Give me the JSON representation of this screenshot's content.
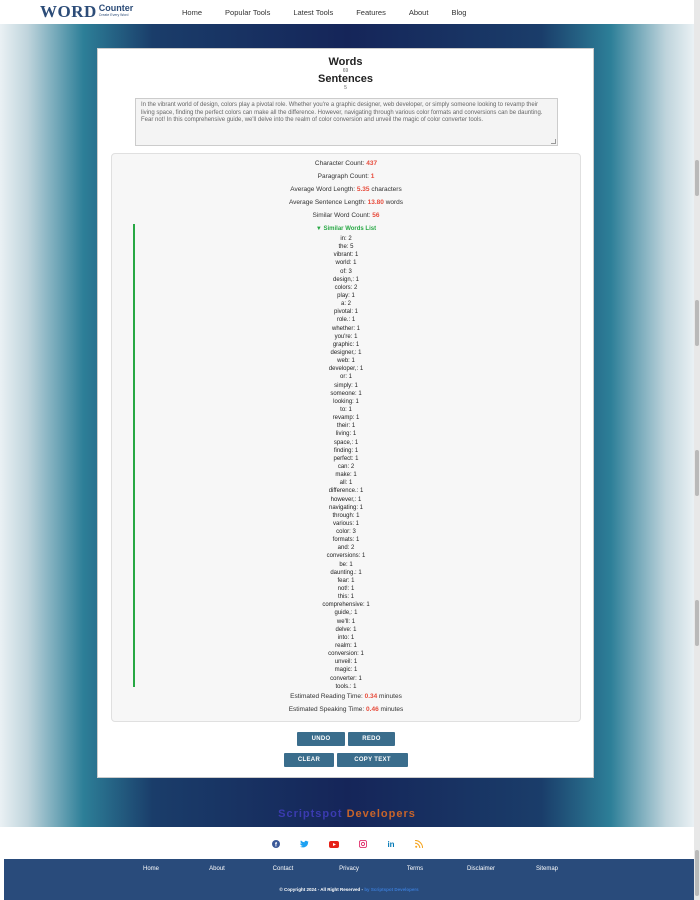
{
  "logo": {
    "word": "WORD",
    "counter": "Counter",
    "tagline": "Create Every Word"
  },
  "nav": [
    "Home",
    "Popular Tools",
    "Latest Tools",
    "Features",
    "About",
    "Blog"
  ],
  "stats": {
    "words_label": "Words",
    "words_count": "69",
    "sentences_label": "Sentences",
    "sentences_count": "5"
  },
  "textarea": {
    "value": "In the vibrant world of design, colors play a pivotal role. Whether you're a graphic designer, web developer, or simply someone looking to revamp their living space, finding the perfect colors can make all the difference. However, navigating through various color formats and conversions can be daunting. Fear not! In this comprehensive guide, we'll delve into the realm of color conversion and unveil the magic of color converter tools."
  },
  "results": {
    "char_label": "Character Count: ",
    "char_value": "437",
    "para_label": "Paragraph Count: ",
    "para_value": "1",
    "awl_label": "Average Word Length: ",
    "awl_value": "5.35",
    "awl_unit": " characters",
    "asl_label": "Average Sentence Length: ",
    "asl_value": "13.80",
    "asl_unit": " words",
    "sim_label": "Similar Word Count: ",
    "sim_value": "56",
    "sim_head": "▼ Similar Words List",
    "similar_words": [
      "in: 2",
      "the: 5",
      "vibrant: 1",
      "world: 1",
      "of: 3",
      "design,: 1",
      "colors: 2",
      "play: 1",
      "a: 2",
      "pivotal: 1",
      "role.: 1",
      "whether: 1",
      "you're: 1",
      "graphic: 1",
      "designer,: 1",
      "web: 1",
      "developer,: 1",
      "or: 1",
      "simply: 1",
      "someone: 1",
      "looking: 1",
      "to: 1",
      "revamp: 1",
      "their: 1",
      "living: 1",
      "space,: 1",
      "finding: 1",
      "perfect: 1",
      "can: 2",
      "make: 1",
      "all: 1",
      "difference.: 1",
      "however,: 1",
      "navigating: 1",
      "through: 1",
      "various: 1",
      "color: 3",
      "formats: 1",
      "and: 2",
      "conversions: 1",
      "be: 1",
      "daunting.: 1",
      "fear: 1",
      "not!: 1",
      "this: 1",
      "comprehensive: 1",
      "guide,: 1",
      "we'll: 1",
      "delve: 1",
      "into: 1",
      "realm: 1",
      "conversion: 1",
      "unveil: 1",
      "magic: 1",
      "converter: 1",
      "tools.: 1"
    ],
    "read_label": "Estimated Reading Time: ",
    "read_value": "0.34",
    "read_unit": " minutes",
    "speak_label": "Estimated Speaking Time: ",
    "speak_value": "0.46",
    "speak_unit": " minutes"
  },
  "buttons": {
    "undo": "UNDO",
    "redo": "REDO",
    "clear": "CLEAR",
    "copy": "COPY TEXT"
  },
  "brand": {
    "part1": "Scriptspot",
    "part2": " Developers"
  },
  "social_icons": [
    "facebook-icon",
    "twitter-icon",
    "youtube-icon",
    "instagram-icon",
    "linkedin-icon",
    "rss-icon"
  ],
  "footer": {
    "links": [
      "Home",
      "About",
      "Contact",
      "Privacy",
      "Terms",
      "Disclaimer",
      "Sitemap"
    ],
    "copyright": "© Copyright 2024 - All Right Reserved - ",
    "copyright_by": "by Scriptspot Developers"
  }
}
